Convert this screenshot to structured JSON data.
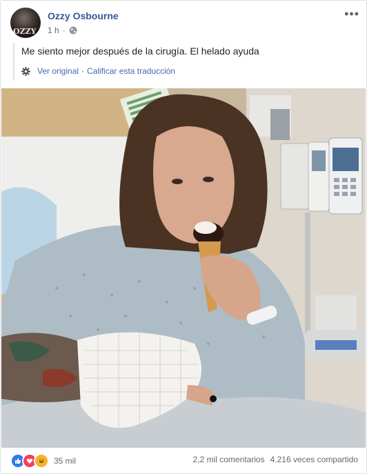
{
  "post": {
    "author": "Ozzy Osbourne",
    "avatar_text": "OZZY",
    "timestamp": "1 h",
    "privacy_icon": "globe-icon",
    "more_icon": "more-horizontal-icon",
    "translated_text": "Me siento mejor después de la cirugía. El helado ayuda",
    "translation_actions": {
      "settings_icon": "gear-icon",
      "view_original": "Ver original",
      "separator": "·",
      "rate_translation": "Calificar esta traducción"
    },
    "photo_icon": "photo"
  },
  "footer": {
    "reaction_icons": [
      "like-icon",
      "love-icon",
      "haha-icon"
    ],
    "reaction_count": "35 mil",
    "comments": "2,2 mil comentarios",
    "shares": "4.216 veces compartido"
  },
  "colors": {
    "link_blue": "#365899",
    "action_blue": "#4267b2",
    "muted_text": "#616770",
    "like": "#3578e5",
    "love": "#f33e58",
    "haha": "#f7b125"
  }
}
